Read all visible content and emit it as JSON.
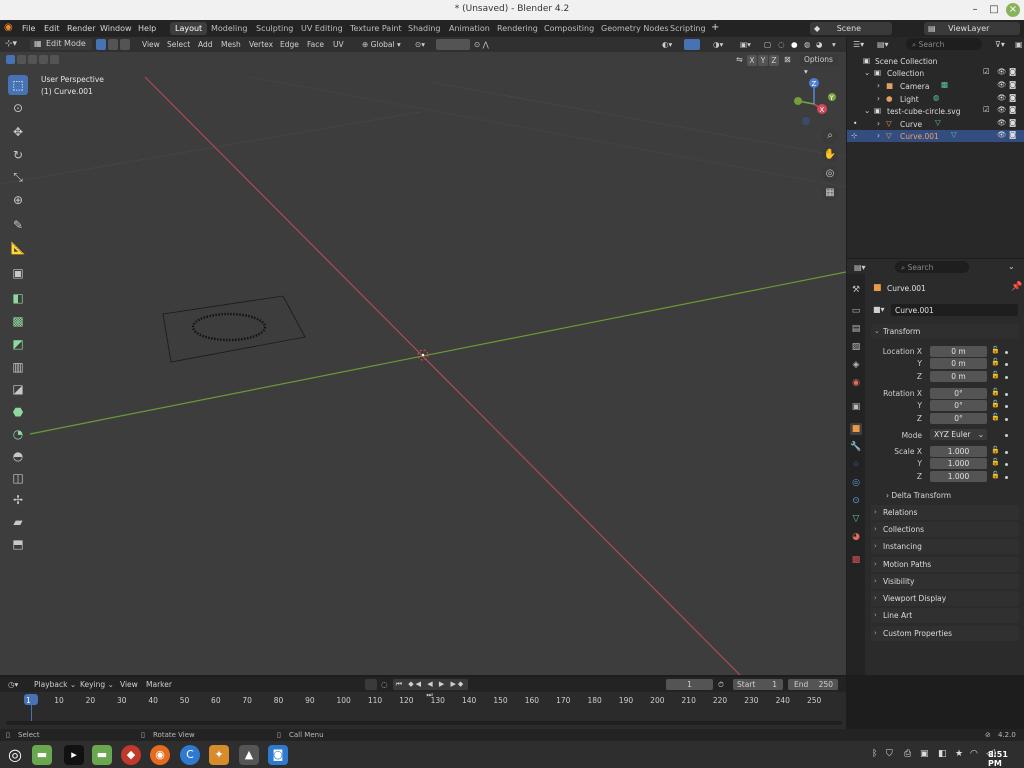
{
  "window": {
    "title": "* (Unsaved) - Blender 4.2"
  },
  "menu": [
    "File",
    "Edit",
    "Render",
    "Window",
    "Help"
  ],
  "workspaces": [
    {
      "label": "Layout",
      "active": true
    },
    {
      "label": "Modeling"
    },
    {
      "label": "Sculpting"
    },
    {
      "label": "UV Editing"
    },
    {
      "label": "Texture Paint"
    },
    {
      "label": "Shading"
    },
    {
      "label": "Animation"
    },
    {
      "label": "Rendering"
    },
    {
      "label": "Compositing"
    },
    {
      "label": "Geometry Nodes"
    },
    {
      "label": "Scripting"
    }
  ],
  "scene": {
    "name": "Scene",
    "view_layer": "ViewLayer"
  },
  "viewport": {
    "mode": "Edit Mode",
    "menus": [
      "View",
      "Select",
      "Add",
      "Mesh",
      "Vertex",
      "Edge",
      "Face",
      "UV"
    ],
    "transform_orientation": "Global",
    "options_label": "Options",
    "axis_toggles": [
      "X",
      "Y",
      "Z"
    ],
    "perspective_label": "User Perspective",
    "object_label": "(1) Curve.001",
    "gizmo": {
      "x": "X",
      "y": "Y",
      "z": "Z"
    }
  },
  "outliner": {
    "search_placeholder": "Search",
    "rows": [
      {
        "label": "Scene Collection"
      },
      {
        "label": "Collection"
      },
      {
        "label": "Camera"
      },
      {
        "label": "Light"
      },
      {
        "label": "test-cube-circle.svg"
      },
      {
        "label": "Curve"
      },
      {
        "label": "Curve.001",
        "selected": true
      }
    ]
  },
  "properties": {
    "search_placeholder": "Search",
    "object_name": "Curve.001",
    "object_field": "Curve.001",
    "transform": {
      "title": "Transform",
      "location_label": "Location X",
      "location": [
        "0 m",
        "0 m",
        "0 m"
      ],
      "rotation_label": "Rotation X",
      "rotation": [
        "0°",
        "0°",
        "0°"
      ],
      "mode_label": "Mode",
      "mode": "XYZ Euler",
      "scale_label": "Scale X",
      "scale": [
        "1.000",
        "1.000",
        "1.000"
      ],
      "y_label": "Y",
      "z_label": "Z",
      "delta": "Delta Transform"
    },
    "panels": [
      "Relations",
      "Collections",
      "Instancing",
      "Motion Paths",
      "Visibility",
      "Viewport Display",
      "Line Art",
      "Custom Properties"
    ]
  },
  "timeline": {
    "menus": [
      "Playback",
      "Keying",
      "View",
      "Marker"
    ],
    "current_frame": "1",
    "start_label": "Start",
    "start": "1",
    "end_label": "End",
    "end": "250",
    "ticks": [
      "1",
      "10",
      "20",
      "30",
      "40",
      "50",
      "60",
      "70",
      "80",
      "90",
      "100",
      "110",
      "120",
      "130",
      "140",
      "150",
      "160",
      "170",
      "180",
      "190",
      "200",
      "210",
      "220",
      "230",
      "240",
      "250"
    ]
  },
  "status": {
    "select": "Select",
    "rotate": "Rotate View",
    "menu": "Call Menu",
    "version": "4.2.0"
  },
  "taskbar": {
    "clock": "8:51 PM"
  }
}
